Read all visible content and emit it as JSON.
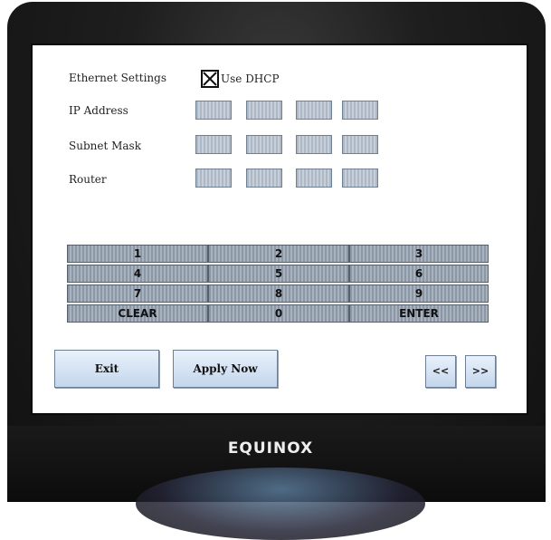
{
  "screen": {
    "ethernet_settings_label": "Ethernet Settings",
    "use_dhcp_label": "Use DHCP",
    "use_dhcp_checked": true,
    "ip_address_label": "IP Address",
    "subnet_mask_label": "Subnet Mask",
    "router_label": "Router",
    "ip_address_octets": [
      "",
      "",
      "",
      ""
    ],
    "subnet_mask_octets": [
      "",
      "",
      "",
      ""
    ],
    "router_octets": [
      "",
      "",
      "",
      ""
    ]
  },
  "keypad": {
    "keys": [
      "1",
      "2",
      "3",
      "4",
      "5",
      "6",
      "7",
      "8",
      "9",
      "CLEAR",
      "0",
      "ENTER"
    ]
  },
  "buttons": {
    "exit_label": "Exit",
    "apply_now_label": "Apply Now",
    "prev_label": "<<",
    "next_label": ">>"
  },
  "device": {
    "brand": "EQUINOX"
  },
  "colors": {
    "button_gradient_top": "#e9f1fb",
    "button_gradient_bottom": "#c3d6ec",
    "key_fill": "#a9b3c0",
    "octet_fill": "#c7cfda",
    "bezel": "#1e1e1e"
  }
}
